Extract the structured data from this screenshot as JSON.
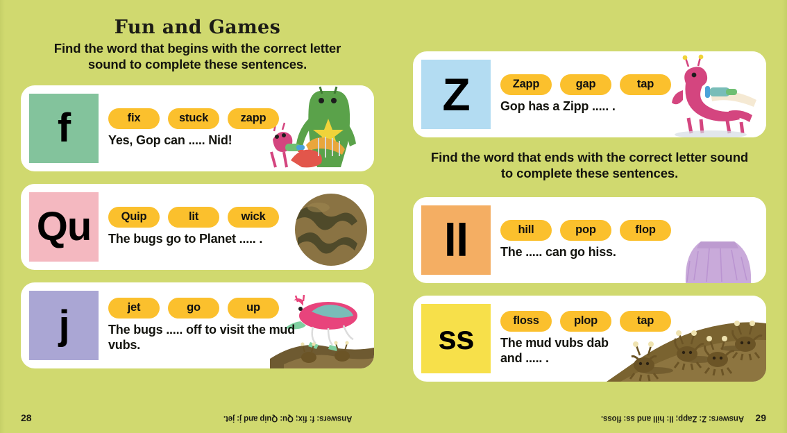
{
  "spread": {
    "background_color": "#d0d96f",
    "pill_color": "#fbc02d",
    "card_color": "#ffffff"
  },
  "left_page": {
    "title": "Fun and Games",
    "instruction": "Find the word that begins with the correct letter sound to complete these sentences.",
    "page_number": "28",
    "answers": "Answers: f: fix; Qu: Quip and j: jet.",
    "cards": [
      {
        "letter": "f",
        "tile_color": "#83c39c",
        "options": [
          "fix",
          "stuck",
          "zapp"
        ],
        "sentence": "Yes, Gop can ..... Nid!",
        "art": "green-monster-with-pink-alien"
      },
      {
        "letter": "Qu",
        "tile_color": "#f4b8c0",
        "options": [
          "Quip",
          "lit",
          "wick"
        ],
        "sentence": "The bugs go to Planet ..... .",
        "art": "mud-planet"
      },
      {
        "letter": "j",
        "tile_color": "#aaa6d4",
        "options": [
          "jet",
          "go",
          "up"
        ],
        "sentence": "The bugs ..... off to visit the mud vubs.",
        "art": "pink-bug-ship-over-mud"
      }
    ]
  },
  "right_page": {
    "instruction": "Find the word that ends with the correct letter sound to complete these sentences.",
    "page_number": "29",
    "answers": "Answers: Z: Zapp; ll: hill and ss: floss.",
    "cards_top": [
      {
        "letter": "Z",
        "tile_color": "#b3dcf2",
        "options": [
          "Zapp",
          "gap",
          "tap"
        ],
        "sentence": "Gop has a Zipp ..... .",
        "art": "pink-dragon-with-zapper"
      }
    ],
    "cards_bottom": [
      {
        "letter": "ll",
        "tile_color": "#f4ae63",
        "options": [
          "hill",
          "pop",
          "flop"
        ],
        "sentence": "The ..... can go hiss.",
        "art": "lilac-volcano"
      },
      {
        "letter": "ss",
        "tile_color": "#f7e04a",
        "options": [
          "floss",
          "plop",
          "tap"
        ],
        "sentence": "The mud vubs dab and ..... .",
        "art": "mud-bugs-on-hill"
      }
    ]
  }
}
